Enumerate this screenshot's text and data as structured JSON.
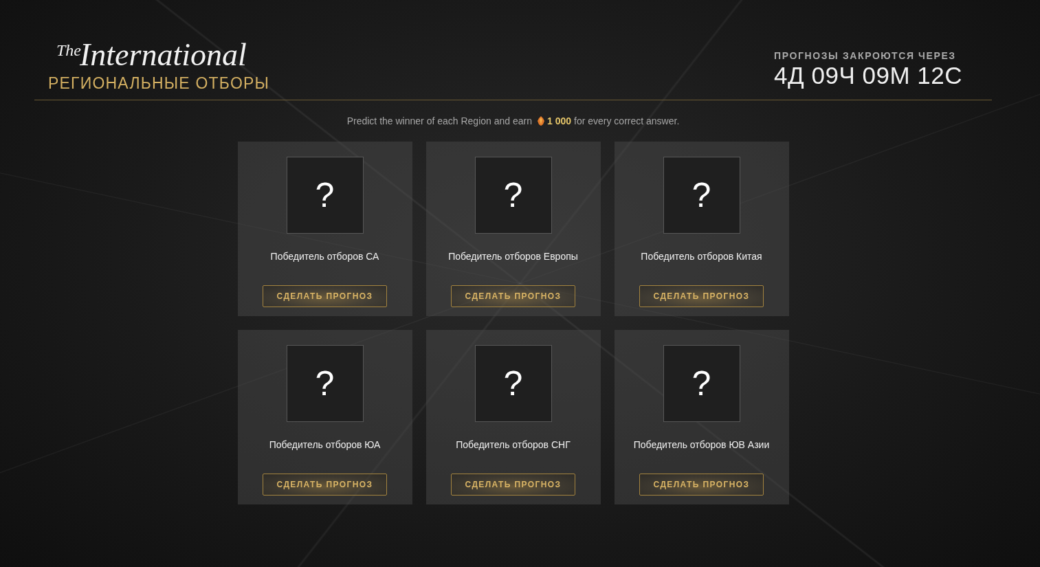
{
  "header": {
    "logo": {
      "prefix": "The",
      "name": "International"
    },
    "subtitle": "РЕГИОНАЛЬНЫЕ ОТБОРЫ"
  },
  "countdown": {
    "label": "ПРОГНОЗЫ ЗАКРОЮТСЯ ЧЕРЕЗ",
    "value": "4Д 09Ч 09М 12С"
  },
  "intro": {
    "before": "Predict the winner of each Region and earn",
    "amount": "1 000",
    "after": "for every correct answer."
  },
  "regions": [
    {
      "slot": "?",
      "title": "Победитель отборов СА",
      "button": "СДЕЛАТЬ ПРОГНОЗ"
    },
    {
      "slot": "?",
      "title": "Победитель отборов Европы",
      "button": "СДЕЛАТЬ ПРОГНОЗ"
    },
    {
      "slot": "?",
      "title": "Победитель отборов Китая",
      "button": "СДЕЛАТЬ ПРОГНОЗ"
    },
    {
      "slot": "?",
      "title": "Победитель отборов ЮА",
      "button": "СДЕЛАТЬ ПРОГНОЗ"
    },
    {
      "slot": "?",
      "title": "Победитель отборов СНГ",
      "button": "СДЕЛАТЬ ПРОГНОЗ"
    },
    {
      "slot": "?",
      "title": "Победитель отборов ЮВ Азии",
      "button": "СДЕЛАТЬ ПРОГНОЗ"
    }
  ]
}
